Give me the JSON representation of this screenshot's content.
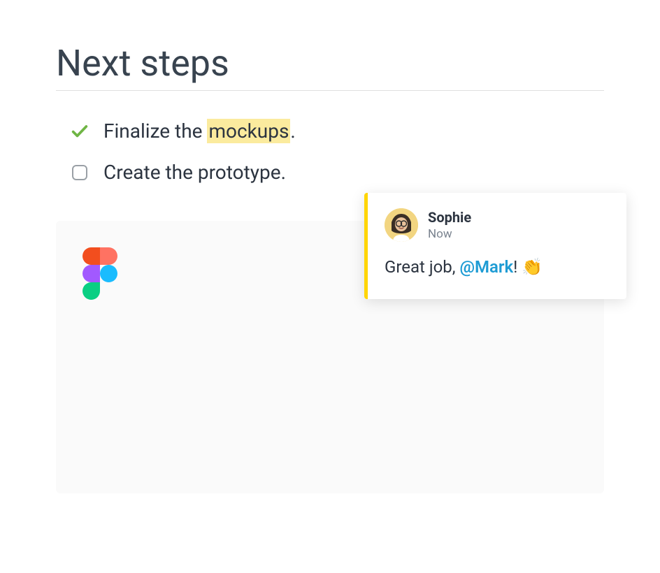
{
  "heading": "Next steps",
  "tasks": [
    {
      "prefix": "Finalize the ",
      "highlight": "mockups",
      "suffix": ".",
      "done": true
    },
    {
      "prefix": "Create the prototype.",
      "highlight": "",
      "suffix": "",
      "done": false
    }
  ],
  "comment": {
    "author": "Sophie",
    "time": "Now",
    "body_prefix": "Great job, ",
    "mention": "@Mark",
    "body_suffix": "! 👏"
  },
  "icons": {
    "figma": "figma-logo"
  }
}
